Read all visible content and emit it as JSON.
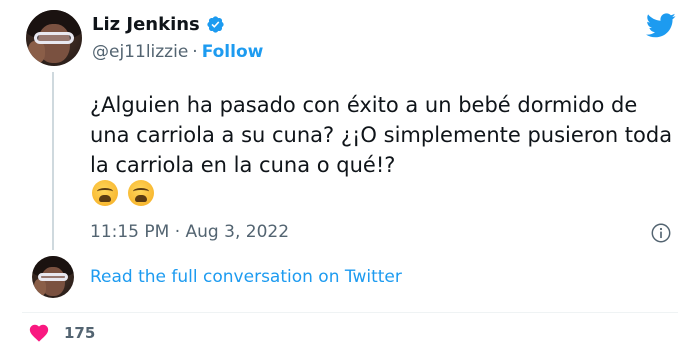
{
  "author": {
    "name": "Liz Jenkins",
    "handle": "@ej11lizzie",
    "separator": "·",
    "follow_label": "Follow",
    "verified_icon": "verified-badge-icon"
  },
  "tweet": {
    "text": "¿Alguien ha pasado con éxito a un bebé dormido de una carriola a su cuna? ¿¡O simplemente pusieron toda la carriola en la cuna o qué!?",
    "emojis": [
      "weary-face-emoji",
      "weary-face-emoji"
    ],
    "timestamp": "11:15 PM · Aug 3, 2022"
  },
  "conversation": {
    "link_label": "Read the full conversation on Twitter"
  },
  "engagement": {
    "like_count": "175",
    "like_icon": "heart-icon"
  },
  "colors": {
    "accent": "#1d9bf0",
    "heart": "#f91880",
    "text": "#0f1419",
    "secondary_text": "#536471"
  }
}
